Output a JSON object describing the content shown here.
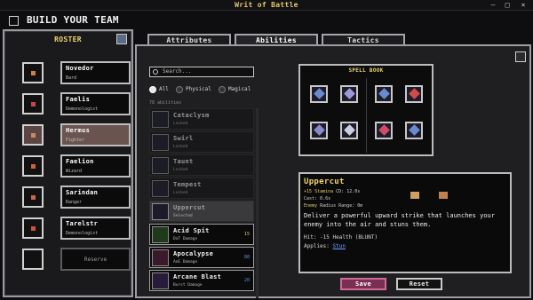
{
  "app": {
    "title": "Writ of Battle",
    "minimize": "—",
    "maximize": "□",
    "close": "×"
  },
  "header": {
    "title": "BUILD YOUR TEAM"
  },
  "roster": {
    "title": "ROSTER",
    "members": [
      {
        "name": "Novedor",
        "class": "Bard",
        "color": "#d08040"
      },
      {
        "name": "Faelis",
        "class": "Demonologist",
        "color": "#c04848"
      },
      {
        "name": "Hermus",
        "class": "Fighter",
        "color": "#c88a60"
      },
      {
        "name": "Faelion",
        "class": "Wizard",
        "color": "#d06040"
      },
      {
        "name": "Sarindan",
        "class": "Ranger",
        "color": "#c86848"
      },
      {
        "name": "Tarelstr",
        "class": "Demonologist",
        "color": "#d05040"
      }
    ],
    "reserve_label": "Reserve"
  },
  "tabs": [
    {
      "label": "Attributes"
    },
    {
      "label": "Abilities"
    },
    {
      "label": "Tactics"
    }
  ],
  "abilities_panel": {
    "search_placeholder": "Search...",
    "filters": [
      {
        "label": "All"
      },
      {
        "label": "Physical"
      },
      {
        "label": "Magical"
      }
    ],
    "count_label": "78 abilities",
    "items": [
      {
        "name": "Cataclysm",
        "sub": "Locked",
        "cost": "",
        "color": "#6a4a8a"
      },
      {
        "name": "Swirl",
        "sub": "Locked",
        "cost": "",
        "color": "#4a4a6a"
      },
      {
        "name": "Taunt",
        "sub": "Locked",
        "cost": "",
        "color": "#8a3a3a"
      },
      {
        "name": "Tempest",
        "sub": "Locked",
        "cost": "",
        "color": "#4a5a8a"
      },
      {
        "name": "Uppercut",
        "sub": "Selected",
        "cost": "",
        "color": "#7a6a9a"
      },
      {
        "name": "Acid Spit",
        "sub": "DoT Damage",
        "cost": "15",
        "color": "#5ad04a"
      },
      {
        "name": "Apocalypse",
        "sub": "AoE Damage",
        "cost": "80",
        "color": "#d04a8a"
      },
      {
        "name": "Arcane Blast",
        "sub": "Burst Damage",
        "cost": "20",
        "color": "#8a6ad0"
      }
    ]
  },
  "spellbook": {
    "title": "SPELL BOOK",
    "slots": [
      {
        "icon": "sword-icon",
        "color": "#6a8ad0"
      },
      {
        "icon": "dagger-icon",
        "color": "#9a9ad8"
      },
      {
        "icon": "blade-icon",
        "color": "#6a8ad0"
      },
      {
        "icon": "fire-icon",
        "color": "#d04a4a"
      },
      {
        "icon": "slash-icon",
        "color": "#8a8ac8"
      },
      {
        "icon": "rune-icon",
        "color": "#c8d0e0"
      },
      {
        "icon": "spear-icon",
        "color": "#d04a6a"
      },
      {
        "icon": "arrow-icon",
        "color": "#6a8ad0"
      }
    ]
  },
  "detail": {
    "name": "Uppercut",
    "stamina_value": "15",
    "stamina_label": "Stamina",
    "cd_label": "CD: 12.0s",
    "cast_label": "Cast: 0.6s",
    "target_label": "Enemy",
    "range_label": "Radius Range: 0m",
    "description": "Deliver a powerful upward strike that launches your enemy into the air and stuns them.",
    "hit": "Hit: -15 Health (BLUNT)",
    "applies_label": "Applies:",
    "applies_status": "Stun"
  },
  "buttons": {
    "save": "Save",
    "reset": "Reset"
  }
}
